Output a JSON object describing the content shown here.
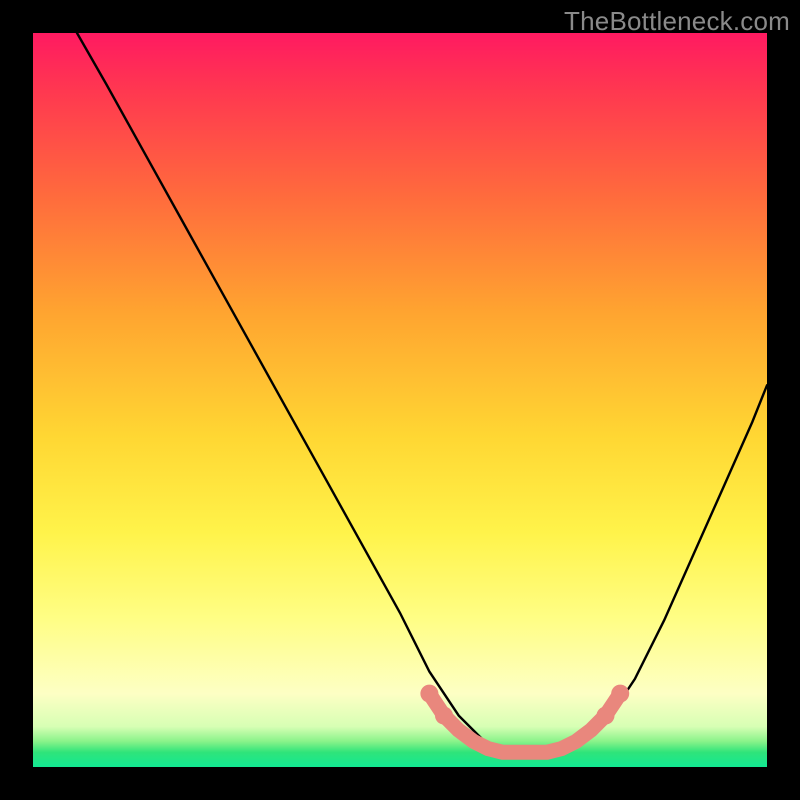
{
  "watermark": "TheBottleneck.com",
  "chart_data": {
    "type": "line",
    "title": "",
    "xlabel": "",
    "ylabel": "",
    "xlim": [
      0,
      100
    ],
    "ylim": [
      0,
      100
    ],
    "grid": false,
    "series": [
      {
        "name": "black-curve",
        "color": "#000000",
        "x": [
          6,
          10,
          15,
          20,
          25,
          30,
          35,
          40,
          45,
          50,
          54,
          58,
          62,
          66,
          70,
          74,
          78,
          82,
          86,
          90,
          94,
          98,
          100
        ],
        "values": [
          100,
          93,
          84,
          75,
          66,
          57,
          48,
          39,
          30,
          21,
          13,
          7,
          3,
          2,
          2,
          3,
          6,
          12,
          20,
          29,
          38,
          47,
          52
        ]
      },
      {
        "name": "pink-band",
        "color": "#e9877d",
        "x": [
          54,
          56,
          58,
          60,
          62,
          64,
          66,
          68,
          70,
          72,
          74,
          76,
          78,
          80
        ],
        "values": [
          10,
          7,
          5,
          3.5,
          2.5,
          2,
          2,
          2,
          2,
          2.5,
          3.5,
          5,
          7,
          10
        ]
      }
    ],
    "gradient_stops": [
      {
        "pos": 0,
        "color": "#ff1a61"
      },
      {
        "pos": 0.22,
        "color": "#ff6a3d"
      },
      {
        "pos": 0.55,
        "color": "#ffd733"
      },
      {
        "pos": 0.8,
        "color": "#fffe86"
      },
      {
        "pos": 0.96,
        "color": "#8af38a"
      },
      {
        "pos": 1.0,
        "color": "#12e893"
      }
    ]
  }
}
